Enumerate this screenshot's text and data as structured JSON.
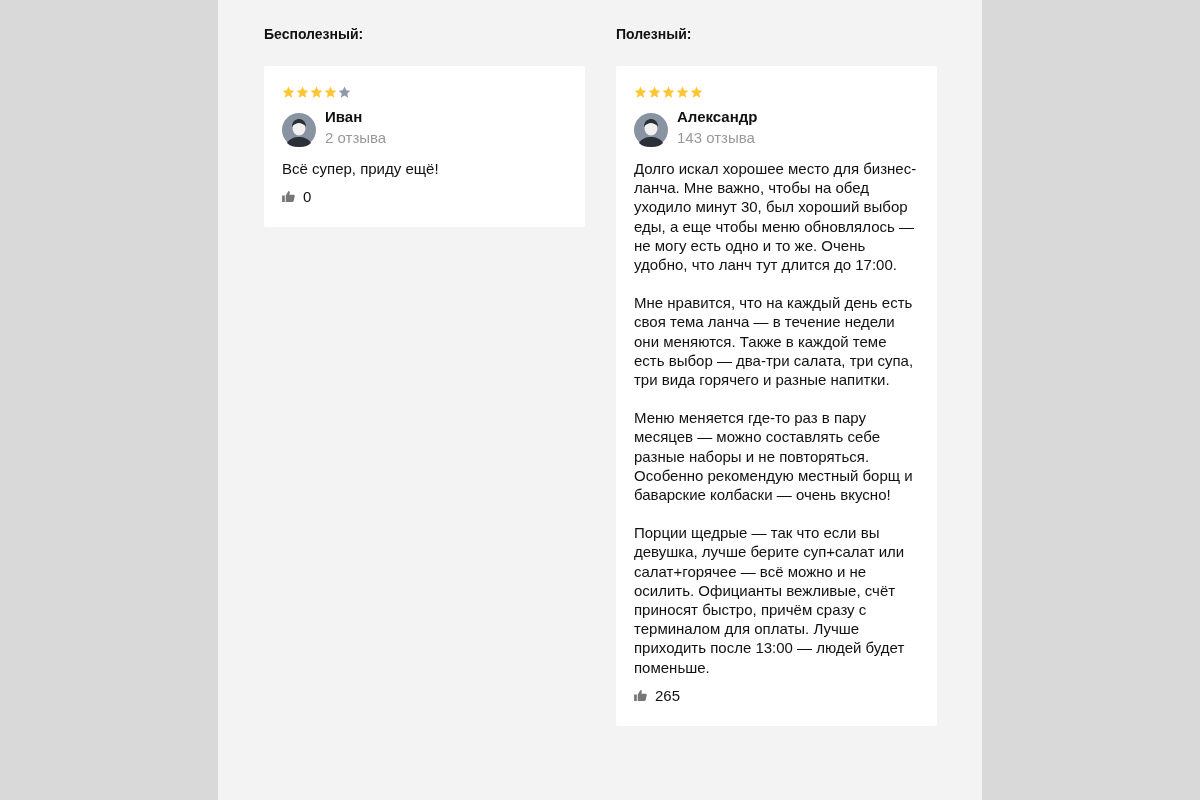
{
  "columns": [
    {
      "heading": "Бесполезный:",
      "review": {
        "stars": 4,
        "author": "Иван",
        "reviews_count": "2 отзыва",
        "paragraphs": [
          "Всё супер, приду ещё!"
        ],
        "likes": "0"
      }
    },
    {
      "heading": "Полезный:",
      "review": {
        "stars": 5,
        "author": "Александр",
        "reviews_count": "143 отзыва",
        "paragraphs": [
          "Долго искал хорошее место для бизнес-ланча. Мне важно, чтобы на обед уходило минут 30, был хороший выбор еды, а еще чтобы меню обновлялось — не могу есть одно и то же. Очень удобно, что ланч тут длится до 17:00.",
          "Мне нравится, что на каждый день есть своя тема ланча — в течение недели они меняются. Также в каждой теме есть выбор — два-три салата, три супа, три вида горячего и разные напитки.",
          "Меню меняется где-то раз в пару месяцев — можно составлять себе разные наборы и не повторяться. Особенно рекомендую местный борщ и баварские колбаски — очень вкусно!",
          "Порции щедрые — так что если вы девушка, лучше берите суп+салат или салат+горячее — всё можно и не осилить. Официанты вежливые, счёт приносят быстро, причём сразу с терминалом для оплаты. Лучше приходить после 13:00 — людей будет поменьше."
        ],
        "likes": "265"
      }
    }
  ]
}
